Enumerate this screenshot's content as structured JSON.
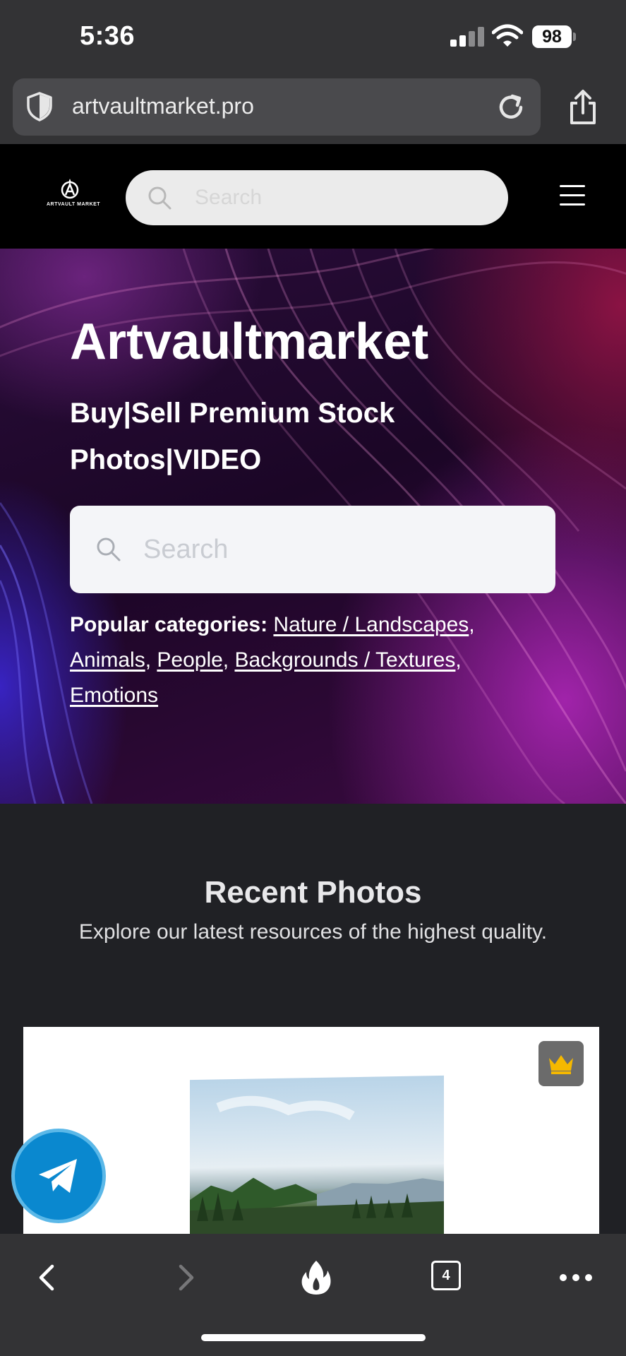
{
  "status_bar": {
    "time": "5:36",
    "battery": "98"
  },
  "browser": {
    "url": "artvaultmarket.pro",
    "tab_count": "4"
  },
  "site_header": {
    "logo_text": "ARTVAULT MARKET",
    "search_placeholder": "Search"
  },
  "hero": {
    "title": "Artvaultmarket",
    "subtitle": "Buy|Sell Premium Stock Photos|VIDEO",
    "search_placeholder": "Search",
    "popular_label": "Popular categories:",
    "categories": [
      "Nature / Landscapes",
      "Animals",
      "People",
      "Backgrounds / Textures",
      "Emotions"
    ]
  },
  "recent": {
    "title": "Recent Photos",
    "subtitle": "Explore our latest resources of the highest quality."
  },
  "icons": {
    "premium_badge": "crown-icon",
    "floating_button": "telegram-icon",
    "toolbar": [
      "back-icon",
      "forward-icon",
      "flame-icon",
      "tabs-icon",
      "more-icon"
    ]
  },
  "colors": {
    "brand_black": "#000000",
    "page_bg": "#202125",
    "telegram": "#0a88cf",
    "crown": "#f5b800"
  }
}
